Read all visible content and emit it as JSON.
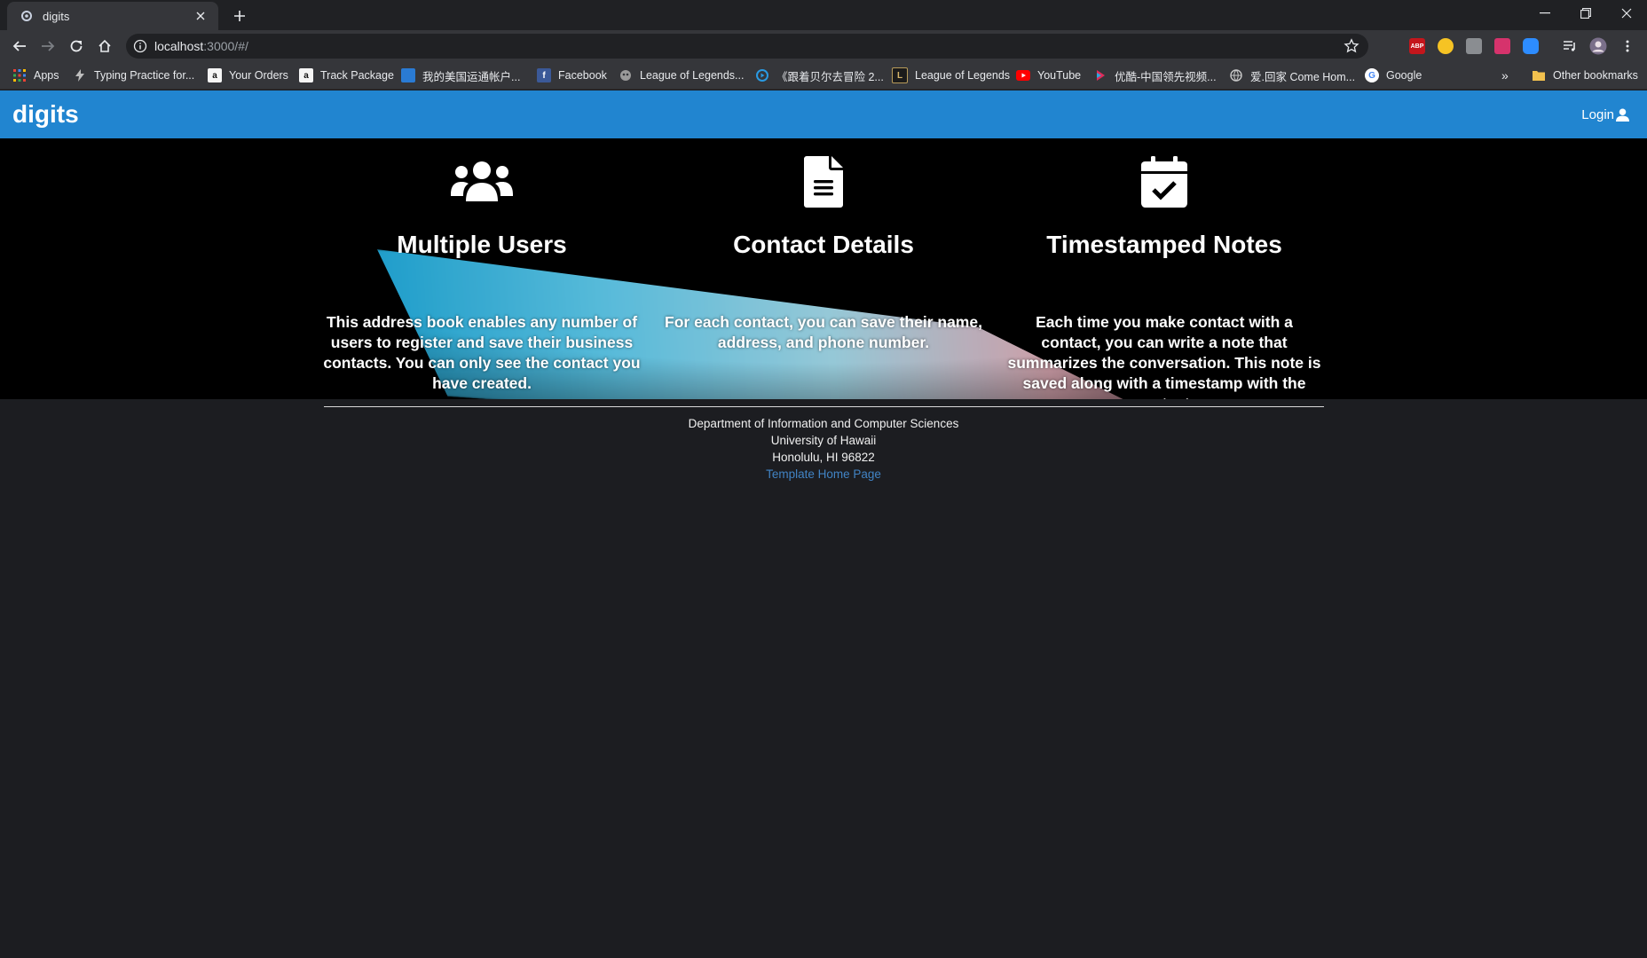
{
  "browser": {
    "tab_title": "digits",
    "url_host": "localhost",
    "url_rest": ":3000/#/",
    "bookmarks": [
      {
        "label": "Apps",
        "icon": "apps-grid-icon",
        "color": "#f4b400"
      },
      {
        "label": "Typing Practice for...",
        "icon": "bolt-icon",
        "color": "#202124"
      },
      {
        "label": "Your Orders",
        "icon": "amazon-icon",
        "color": "#f5f5f5"
      },
      {
        "label": "Track Package",
        "icon": "amazon-icon",
        "color": "#f5f5f5"
      },
      {
        "label": "我的美国运通帐户...",
        "icon": "amex-icon",
        "color": "#2a7bd4"
      },
      {
        "label": "Facebook",
        "icon": "facebook-icon",
        "color": "#3b5998"
      },
      {
        "label": "League of Legends...",
        "icon": "lol-icon",
        "color": "#6b6b6b"
      },
      {
        "label": "《跟着贝尔去冒险 2...",
        "icon": "video-icon",
        "color": "#2a9ae2"
      },
      {
        "label": "League of Legends",
        "icon": "lol-l-icon",
        "color": "#1b1b1b"
      },
      {
        "label": "YouTube",
        "icon": "youtube-icon",
        "color": "#ff0000"
      },
      {
        "label": "优酷-中国领先视频...",
        "icon": "youku-icon",
        "color": "#e02b5a"
      },
      {
        "label": "爱.回家 Come Hom...",
        "icon": "globe-icon",
        "color": "#5f6368"
      },
      {
        "label": "Google",
        "icon": "google-icon",
        "color": "#ffffff"
      }
    ],
    "other_bookmarks": "Other bookmarks"
  },
  "navbar": {
    "brand": "digits",
    "login": "Login"
  },
  "features": [
    {
      "icon": "users-icon",
      "title": "Multiple Users",
      "text": "This address book enables any number of users to register and save their business contacts. You can only see the contact you have created."
    },
    {
      "icon": "document-icon",
      "title": "Contact Details",
      "text": "For each contact, you can save their name, address, and phone number."
    },
    {
      "icon": "calendar-check-icon",
      "title": "Timestamped Notes",
      "text": "Each time you make contact with a contact, you can write a note that summarizes the conversation. This note is saved along with a timestamp with the contact."
    }
  ],
  "footer": {
    "line1": "Department of Information and Computer Sciences",
    "line2": "University of Hawaii",
    "line3": "Honolulu, HI 96822",
    "link": "Template Home Page"
  },
  "colors": {
    "navbar": "#2185d0",
    "link": "#4183c4",
    "background": "#1c1d21"
  }
}
